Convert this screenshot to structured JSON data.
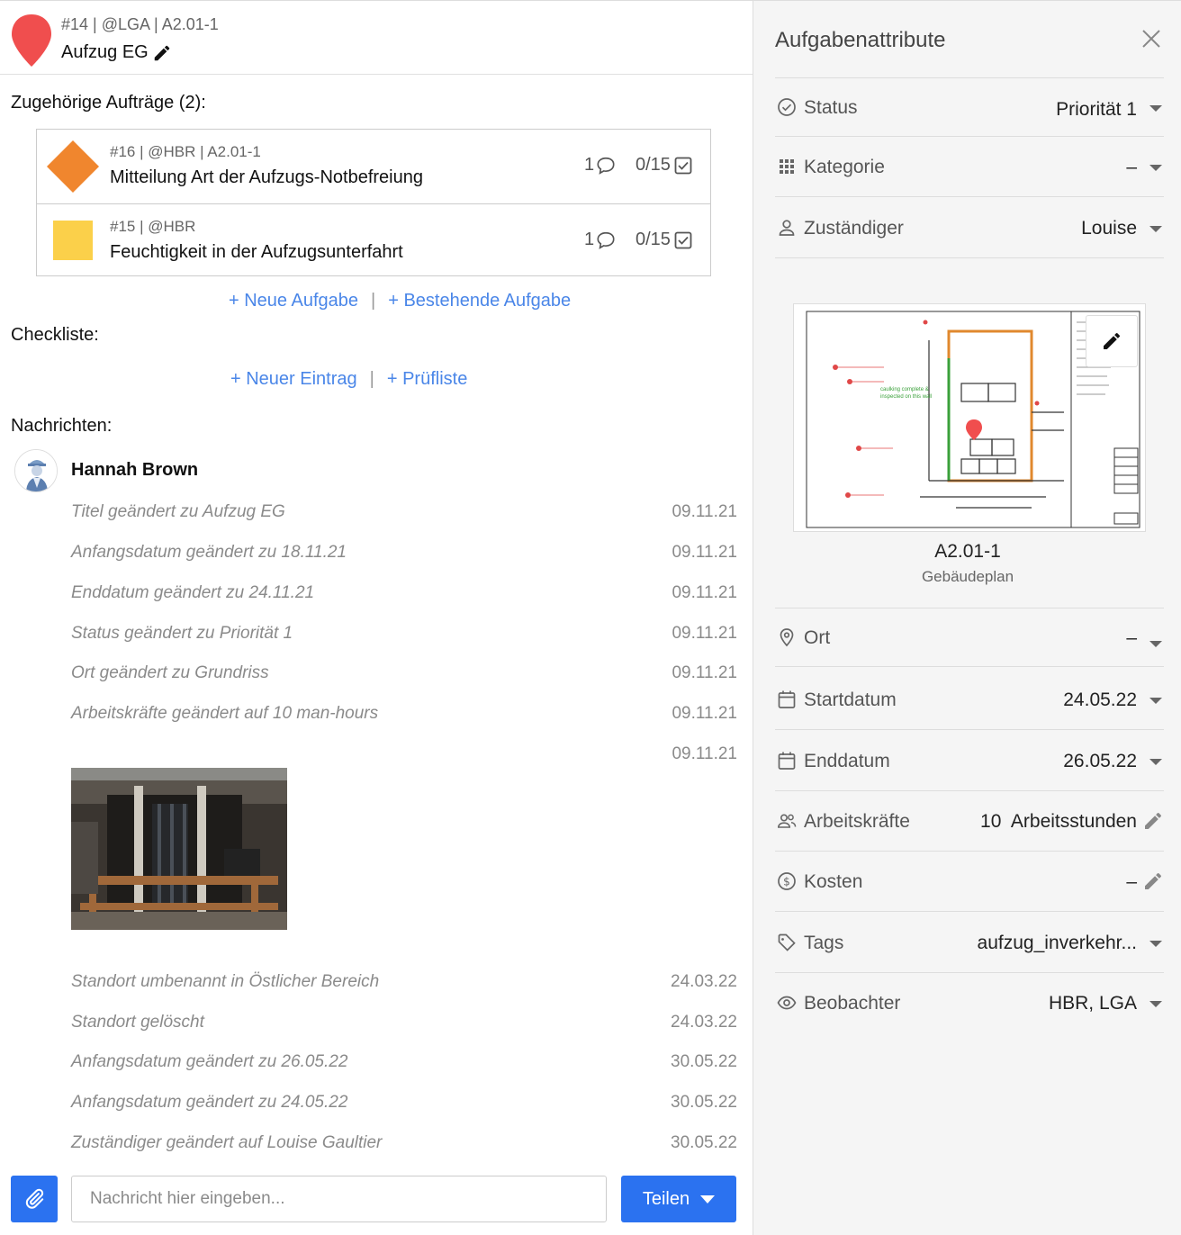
{
  "header": {
    "meta": "#14 | @LGA | A2.01-1",
    "title": "Aufzug EG",
    "pin_color": "#f04e4e"
  },
  "related": {
    "title": "Zugehörige Aufträge (2):",
    "items": [
      {
        "meta": "#16 | @HBR | A2.01-1",
        "title": "Mitteilung Art der Aufzugs-Notbefreiung",
        "comments": "1",
        "checks": "0/15",
        "shape": "diamond",
        "color": "#f0862e"
      },
      {
        "meta": "#15 | @HBR",
        "title": "Feuchtigkeit in der Aufzugsunterfahrt",
        "comments": "1",
        "checks": "0/15",
        "shape": "square",
        "color": "#fbd04a"
      }
    ],
    "new_task": "+ Neue Aufgabe",
    "existing_task": "+ Bestehende Aufgabe",
    "separator": "|"
  },
  "checklist": {
    "title": "Checkliste:",
    "new_entry": "+ Neuer Eintrag",
    "checklist_link": "+ Prüfliste",
    "separator": "|"
  },
  "messages": {
    "title": "Nachrichten:",
    "author": "Hannah Brown",
    "entries": [
      {
        "text": "Titel geändert zu Aufzug EG",
        "date": "09.11.21"
      },
      {
        "text": "Anfangsdatum geändert zu 18.11.21",
        "date": "09.11.21"
      },
      {
        "text": "Enddatum geändert zu 24.11.21",
        "date": "09.11.21"
      },
      {
        "text": "Status geändert zu Priorität 1",
        "date": "09.11.21"
      },
      {
        "text": "Ort geändert zu Grundriss",
        "date": "09.11.21"
      },
      {
        "text": "Arbeitskräfte geändert auf 10 man-hours",
        "date": "09.11.21"
      },
      {
        "text": "",
        "date": "09.11.21"
      },
      {
        "text": "Standort umbenannt in Östlicher Bereich",
        "date": "24.03.22"
      },
      {
        "text": "Standort gelöscht",
        "date": "24.03.22"
      },
      {
        "text": "Anfangsdatum geändert zu 26.05.22",
        "date": "30.05.22"
      },
      {
        "text": "Anfangsdatum geändert zu 24.05.22",
        "date": "30.05.22"
      },
      {
        "text": "Zuständiger geändert auf Louise Gaultier",
        "date": "30.05.22"
      }
    ]
  },
  "composer": {
    "placeholder": "Nachricht hier eingeben...",
    "share_label": "Teilen",
    "accent": "#2b72f0"
  },
  "attributes": {
    "title": "Aufgabenattribute",
    "status": {
      "label": "Status",
      "value": "Priorität 1"
    },
    "category": {
      "label": "Kategorie",
      "value": "–"
    },
    "assignee": {
      "label": "Zuständiger",
      "value": "Louise"
    },
    "plan": {
      "name": "A2.01-1",
      "type": "Gebäudeplan"
    },
    "location": {
      "label": "Ort",
      "value": "–"
    },
    "start_date": {
      "label": "Startdatum",
      "value": "24.05.22"
    },
    "end_date": {
      "label": "Enddatum",
      "value": "26.05.22"
    },
    "workforce": {
      "label": "Arbeitskräfte",
      "value": "10  Arbeitsstunden"
    },
    "costs": {
      "label": "Kosten",
      "value": "–"
    },
    "tags": {
      "label": "Tags",
      "value": "aufzug_inverkehr..."
    },
    "watchers": {
      "label": "Beobachter",
      "value": "HBR, LGA"
    }
  }
}
